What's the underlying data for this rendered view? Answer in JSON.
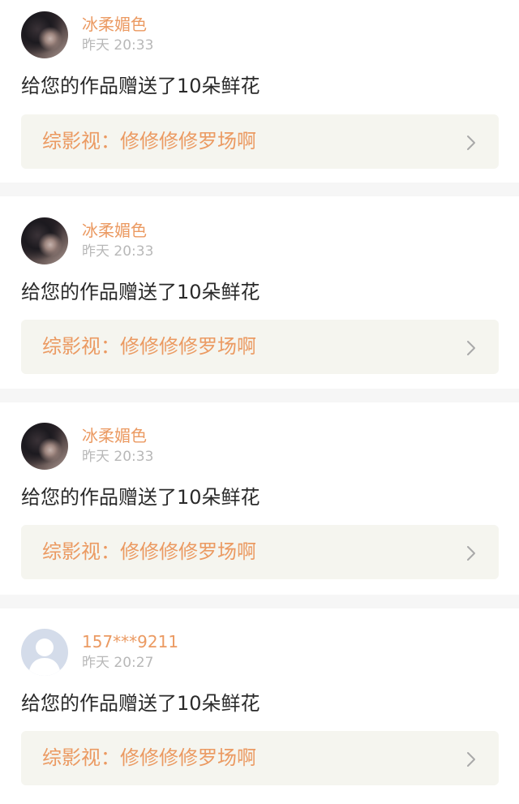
{
  "notifications": [
    {
      "username": "冰柔媚色",
      "time": "昨天 20:33",
      "message": "给您的作品赠送了10朵鲜花",
      "work_title": "综影视：修修修修罗场啊",
      "avatar": "user-photo"
    },
    {
      "username": "冰柔媚色",
      "time": "昨天 20:33",
      "message": "给您的作品赠送了10朵鲜花",
      "work_title": "综影视：修修修修罗场啊",
      "avatar": "user-photo"
    },
    {
      "username": "冰柔媚色",
      "time": "昨天 20:33",
      "message": "给您的作品赠送了10朵鲜花",
      "work_title": "综影视：修修修修罗场啊",
      "avatar": "user-photo"
    },
    {
      "username": "157***9211",
      "time": "昨天 20:27",
      "message": "给您的作品赠送了10朵鲜花",
      "work_title": "综影视：修修修修罗场啊",
      "avatar": "default-avatar-icon"
    }
  ],
  "icons": {
    "chevron": "chevron-right-icon",
    "default_avatar": "default-avatar-icon"
  },
  "colors": {
    "accent": "#eb9a62",
    "tab_indicator": "#e46a99",
    "link_background": "#f5f5ef",
    "page_background": "#f6f6f6"
  }
}
